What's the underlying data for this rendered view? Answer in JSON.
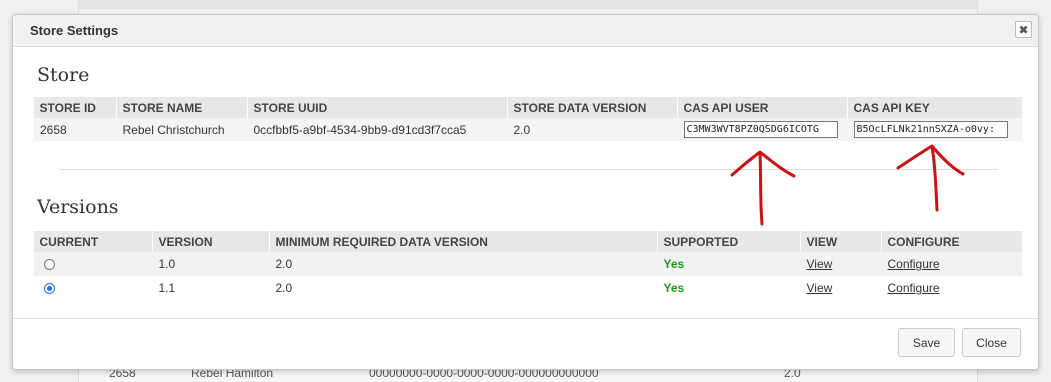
{
  "background": {
    "row": {
      "id": "2658",
      "name": "Rebel Hamilton",
      "uuid": "00000000-0000-0000-0000-000000000000",
      "version": "2.0"
    }
  },
  "dialog": {
    "title": "Store Settings",
    "close_icon": "close-icon",
    "save_label": "Save",
    "close_label": "Close"
  },
  "store": {
    "heading": "Store",
    "columns": [
      "STORE ID",
      "STORE NAME",
      "STORE UUID",
      "STORE DATA VERSION",
      "CAS API USER",
      "CAS API KEY"
    ],
    "row": {
      "id": "2658",
      "name": "Rebel Christchurch",
      "uuid": "0ccfbbf5-a9bf-4534-9bb9-d91cd3f7cca5",
      "data_version": "2.0",
      "api_user": "C3MW3WVT8PZ0QSDG6ICOTG",
      "api_key": "B5OcLFLNk21nnSXZA-o0vy:"
    }
  },
  "versions": {
    "heading": "Versions",
    "columns": [
      "CURRENT",
      "VERSION",
      "MINIMUM REQUIRED DATA VERSION",
      "SUPPORTED",
      "VIEW",
      "CONFIGURE"
    ],
    "rows": [
      {
        "current": false,
        "version": "1.0",
        "min_data_version": "2.0",
        "supported": "Yes",
        "view": "View",
        "configure": "Configure"
      },
      {
        "current": true,
        "version": "1.1",
        "min_data_version": "2.0",
        "supported": "Yes",
        "view": "View",
        "configure": "Configure"
      }
    ]
  },
  "colors": {
    "supported_yes": "#1f9b1f",
    "annotation_arrow": "#cc1111",
    "radio_selected": "#1a73e8"
  }
}
